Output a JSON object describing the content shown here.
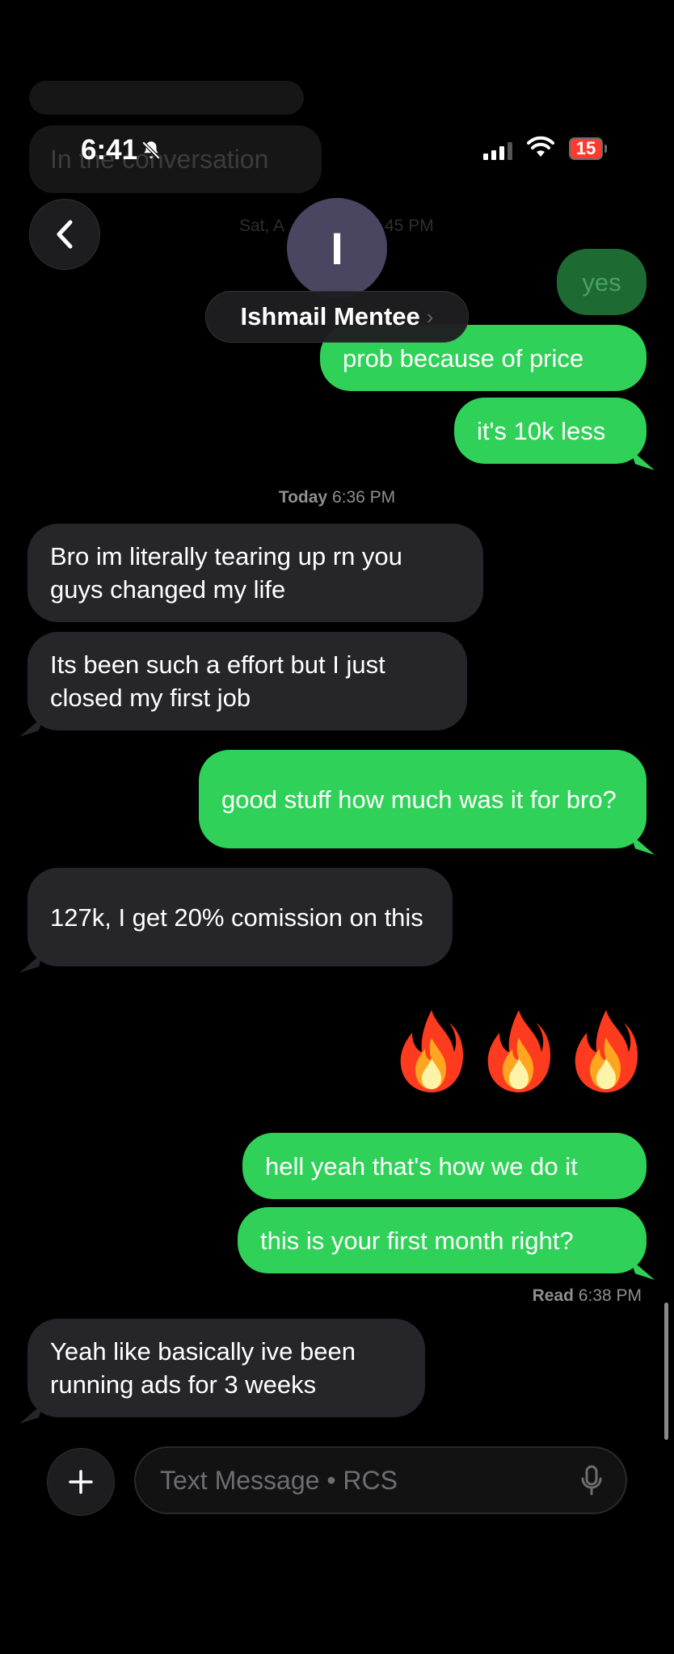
{
  "background_hint": {
    "partial_message_label": "In the conversation",
    "partial_date": "Sat, A",
    "partial_time": "45 PM"
  },
  "status_bar": {
    "time": "6:41",
    "battery": "15"
  },
  "header": {
    "avatar_initial": "I",
    "contact_name": "Ishmail Mentee",
    "contact_chevron": "›"
  },
  "messages": [
    {
      "id": "m0",
      "direction": "sent",
      "text": "yes"
    },
    {
      "id": "m1",
      "direction": "sent",
      "text": "prob because of price"
    },
    {
      "id": "m2",
      "direction": "sent",
      "text": "it's 10k less"
    },
    {
      "id": "m3",
      "direction": "received",
      "text": "Bro im literally tearing up rn you guys changed my life"
    },
    {
      "id": "m4",
      "direction": "received",
      "text": "Its been such a effort but I just closed my first job"
    },
    {
      "id": "m5",
      "direction": "sent",
      "text": "good stuff how much was it for bro?"
    },
    {
      "id": "m6",
      "direction": "received",
      "text": "127k, I get 20% comission on this"
    },
    {
      "id": "m7",
      "direction": "sent",
      "text": "🔥🔥🔥"
    },
    {
      "id": "m8",
      "direction": "sent",
      "text": "hell yeah that's how we do it"
    },
    {
      "id": "m9",
      "direction": "sent",
      "text": "this is your first month right?"
    },
    {
      "id": "m10",
      "direction": "received",
      "text": "Yeah like basically ive been running ads for 3 weeks"
    }
  ],
  "timestamps": {
    "today": {
      "label": "Today",
      "time": "6:36 PM"
    },
    "read": {
      "label": "Read",
      "time": "6:38 PM"
    }
  },
  "composer": {
    "placeholder": "Text Message • RCS"
  },
  "icons": {
    "back": "chevron-left-icon",
    "bell_muted": "bell-slash-icon",
    "signal": "cellular-signal-icon",
    "wifi": "wifi-icon",
    "plus": "plus-icon",
    "mic": "microphone-icon",
    "fire": "fire-emoji"
  },
  "colors": {
    "sent_bubble": "#30d158",
    "received_bubble": "#26252a",
    "battery_low": "#ff3b30"
  }
}
